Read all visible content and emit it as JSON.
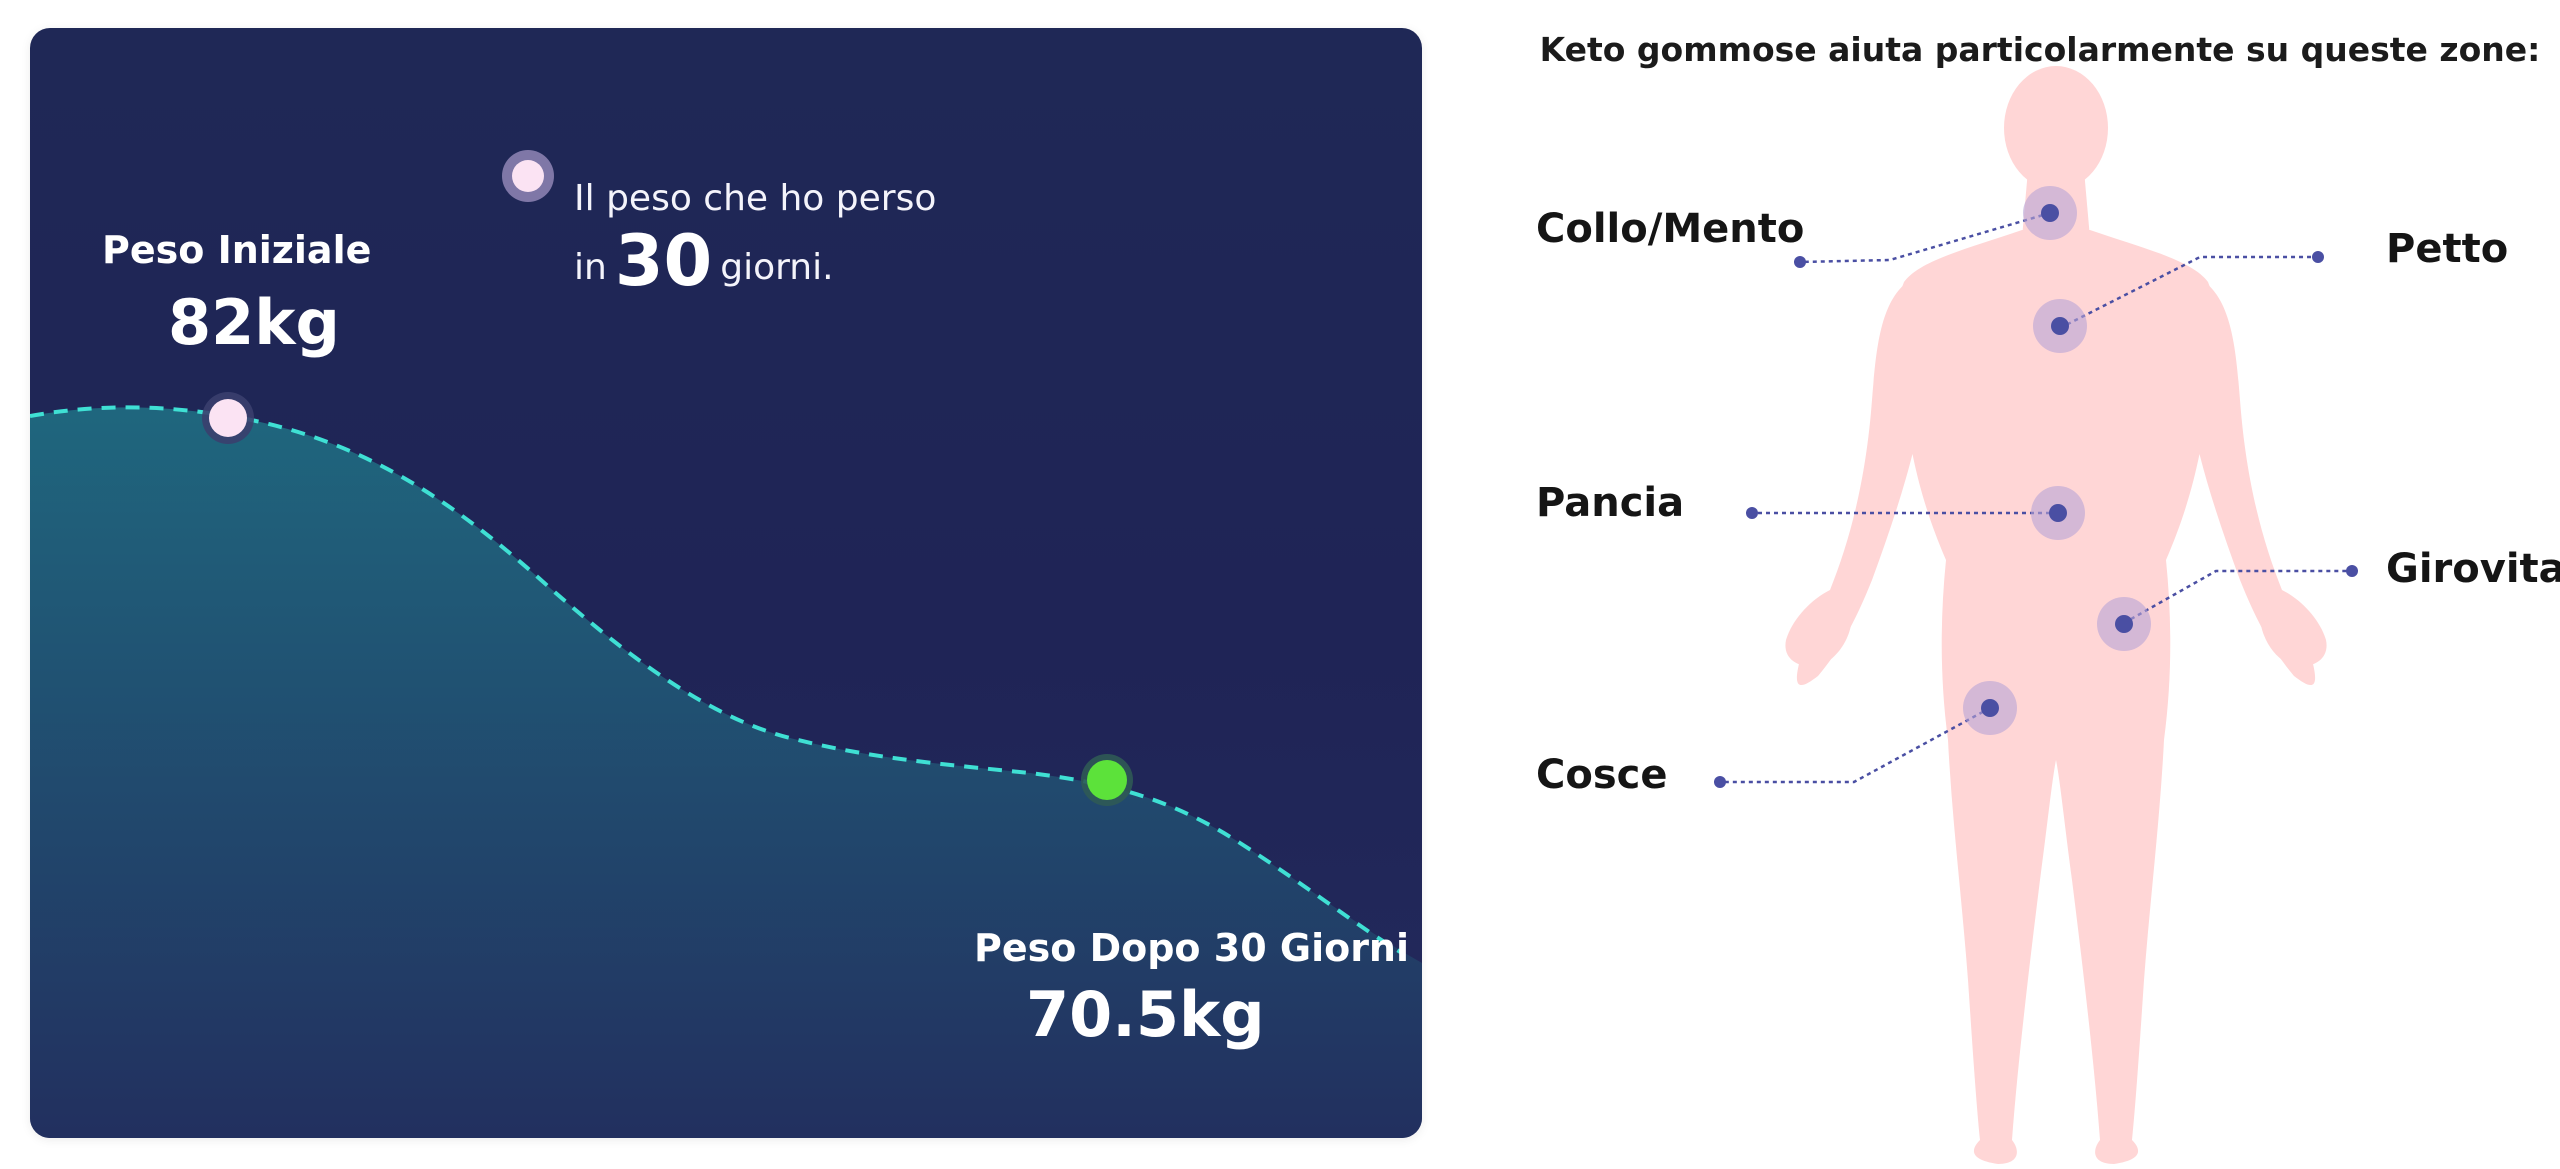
{
  "chart": {
    "legend_text_line1": "Il peso che ho perso",
    "legend_text_in": "in",
    "legend_days": "30",
    "legend_text_after": "giorni.",
    "start_label": "Peso Iniziale",
    "start_value": "82kg",
    "end_label": "Peso Dopo 30 Giorni",
    "end_value": "70.5kg",
    "colors": {
      "background": "#1f2656",
      "curve": "#3fe0d4",
      "area": "#1e5f78",
      "start_dot": "#fbe3f3",
      "end_dot": "#5ce23a"
    }
  },
  "body_panel": {
    "title": "Keto gommose aiuta particolarmente su queste zone:",
    "figure_color": "#ffd6d6",
    "marker_color": "#4a4fa3",
    "zones": [
      {
        "id": "collo",
        "label": "Collo/Mento"
      },
      {
        "id": "petto",
        "label": "Petto"
      },
      {
        "id": "pancia",
        "label": "Pancia"
      },
      {
        "id": "girovita",
        "label": "Girovita"
      },
      {
        "id": "cosce",
        "label": "Cosce"
      }
    ]
  }
}
